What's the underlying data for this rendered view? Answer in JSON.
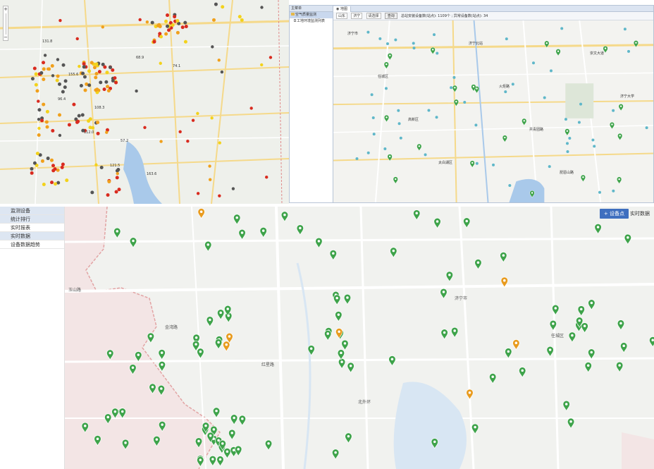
{
  "colors": {
    "map_bg": "#eef0eb",
    "road_yellow": "#f5d98a",
    "road_white": "#ffffff",
    "water": "#a9c9ea",
    "marker_green": "#3ea34a",
    "marker_orange": "#e89b1e",
    "dot_red": "#d92b1f",
    "dot_dark": "#555555",
    "dot_orange": "#f0a01c",
    "dot_yellow": "#f3d21b",
    "accent": "#3f6fbf"
  },
  "top_right": {
    "tree_header": "主菜单",
    "tree_item": "空气质量监测",
    "tree_child": "工地环境监测列表",
    "tab_label": "地图",
    "toolbar": {
      "field1": "山东",
      "field2": "济宁",
      "field3": "请选择",
      "query_button": "查询",
      "summary": "总站安装设备数(站点): 1109个 ; 异常设备数(站点): 34"
    },
    "map_labels": [
      "济宁市",
      "任城区",
      "高新区",
      "太白湖区",
      "济宁北站",
      "火炬路",
      "共青团路",
      "琵琶山路",
      "崇文大道",
      "济宁大学"
    ]
  },
  "bottom": {
    "sidebar": {
      "items": [
        {
          "label": "监测设备"
        },
        {
          "label": "统计排行"
        },
        {
          "label": "实时报表"
        },
        {
          "label": "实时数据"
        },
        {
          "label": "设备数据趋势"
        }
      ]
    },
    "buttons": {
      "add_device": "+ 设备点",
      "realtime": "实时数据"
    },
    "map_labels": [
      "玉山路",
      "金湾路",
      "红星路",
      "北外环",
      "济宁市",
      "任城区"
    ]
  },
  "left_map": {
    "labels": [
      "131.8",
      "155.6",
      "108.3",
      "57.2",
      "163.6",
      "74.1",
      "96.4",
      "112.0",
      "121.5",
      "68.9"
    ]
  }
}
